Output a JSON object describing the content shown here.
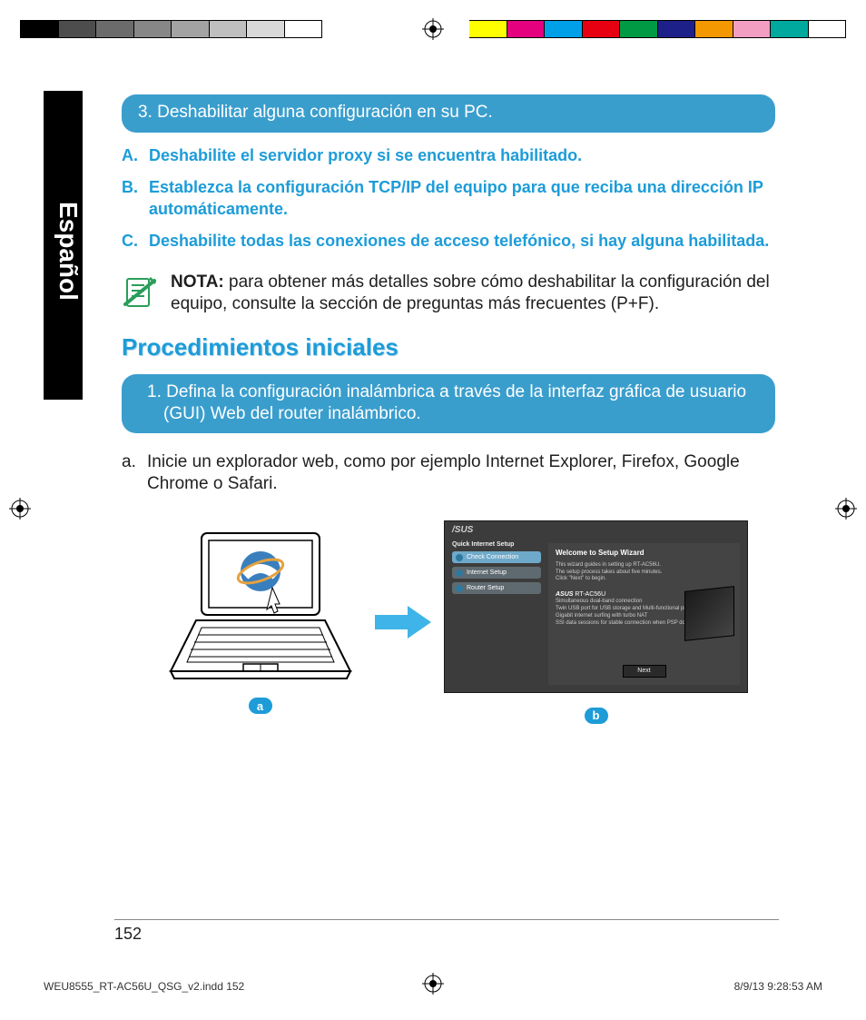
{
  "language_tab": "Español",
  "step3_pill": "3.  Deshabilitar alguna configuración en su PC.",
  "blue_list": [
    {
      "letter": "A.",
      "text": "Deshabilite el servidor proxy si se encuentra habilitado."
    },
    {
      "letter": "B.",
      "text": "Establezca la configuración TCP/IP del equipo para que reciba una dirección IP automáticamente."
    },
    {
      "letter": "C.",
      "text": "Deshabilite todas las conexiones de acceso telefónico, si hay alguna habilitada."
    }
  ],
  "note": {
    "label": "NOTA:",
    "text": " para obtener más detalles sobre cómo deshabilitar la configuración del equipo, consulte la sección de preguntas más frecuentes (P+F)."
  },
  "section_heading": "Procedimientos iniciales",
  "step1_pill": "1.  Defina la configuración inalámbrica a través de la interfaz gráfica de usuario (GUI) Web del router inalámbrico.",
  "step_a": {
    "letter": "a.",
    "text": "Inicie un explorador web, como por ejemplo Internet Explorer, Firefox, Google Chrome o Safari."
  },
  "figure": {
    "label_a": "a",
    "label_b": "b",
    "wizard": {
      "logo": "/SUS",
      "side_header": "Quick Internet Setup",
      "side_items": [
        "Check Connection",
        "Internet Setup",
        "Router Setup"
      ],
      "title": "Welcome to Setup Wizard",
      "intro1": "This wizard guides in setting up RT-AC56U.",
      "intro2": "The setup process takes about five minutes.",
      "intro3": "Click \"Next\" to begin.",
      "model_brand": "ASUS",
      "model_name": "RT-AC56U",
      "feat1": "Simultaneous dual-band connection",
      "feat2": "Twin USB port for USB storage and Multi-functional printer",
      "feat3": "Gigabit internet surfing with turbo NAT",
      "feat4": "SSI data sessions for stable connection when PSP downloading",
      "next": "Next"
    }
  },
  "page_number": "152",
  "slug": "WEU8555_RT-AC56U_QSG_v2.indd   152",
  "slug_date": "8/9/13   9:28:53 AM",
  "colorbar": [
    "#000000",
    "#4d4d4d",
    "#6b6b6b",
    "#878787",
    "#a3a3a3",
    "#bfbfbf",
    "#d9d9d9",
    "#ffffff",
    "spacer",
    "#ffff00",
    "#e4007f",
    "#00a0e9",
    "#e60012",
    "#009944",
    "#1d2088",
    "#f39800",
    "#f19ec2",
    "#00a99d",
    "#ffffff"
  ]
}
